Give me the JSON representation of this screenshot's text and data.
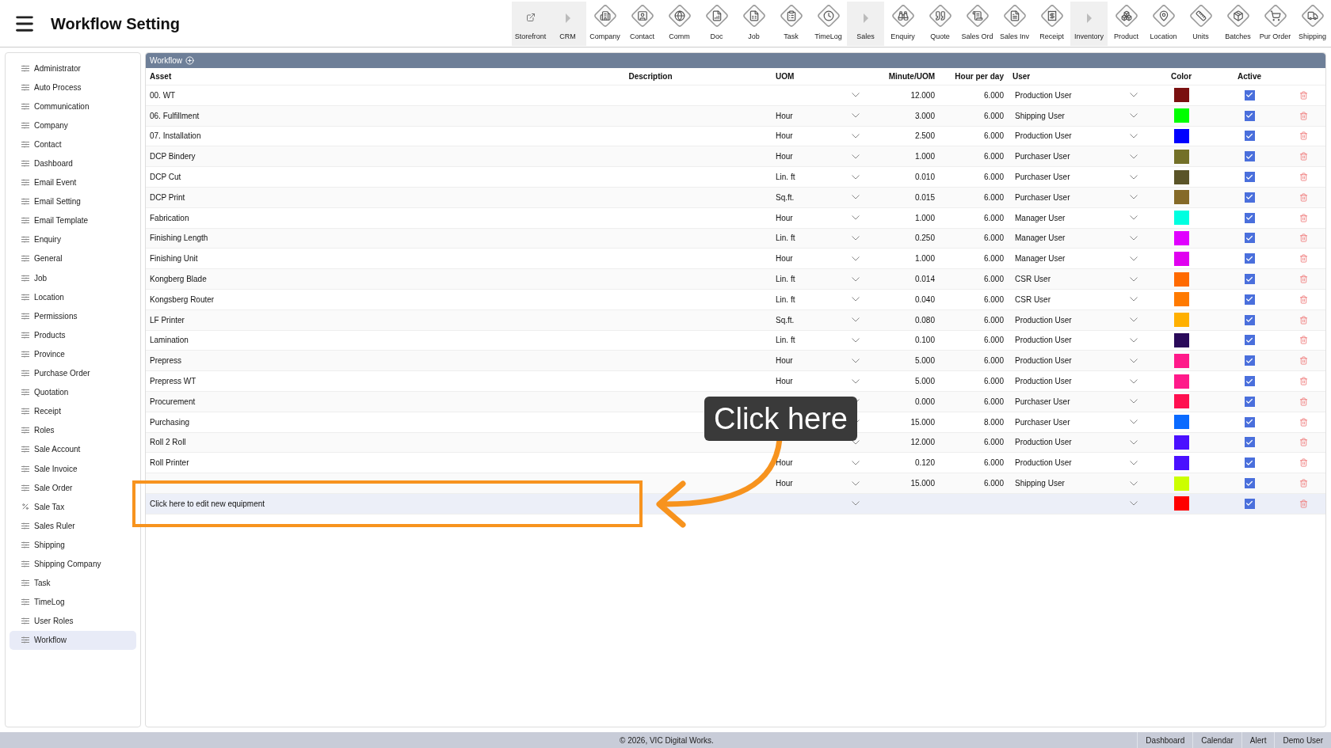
{
  "header": {
    "title": "Workflow Setting"
  },
  "toolbar": [
    {
      "label": "Storefront",
      "kind": "external"
    },
    {
      "label": "CRM",
      "kind": "section"
    },
    {
      "label": "Company",
      "kind": "module"
    },
    {
      "label": "Contact",
      "kind": "module"
    },
    {
      "label": "Comm",
      "kind": "module"
    },
    {
      "label": "Doc",
      "kind": "module"
    },
    {
      "label": "Job",
      "kind": "module"
    },
    {
      "label": "Task",
      "kind": "module"
    },
    {
      "label": "TimeLog",
      "kind": "module"
    },
    {
      "label": "Sales",
      "kind": "section"
    },
    {
      "label": "Enquiry",
      "kind": "module"
    },
    {
      "label": "Quote",
      "kind": "module"
    },
    {
      "label": "Sales Ord",
      "kind": "module"
    },
    {
      "label": "Sales Inv",
      "kind": "module"
    },
    {
      "label": "Receipt",
      "kind": "module"
    },
    {
      "label": "Inventory",
      "kind": "section"
    },
    {
      "label": "Product",
      "kind": "module"
    },
    {
      "label": "Location",
      "kind": "module"
    },
    {
      "label": "Units",
      "kind": "module"
    },
    {
      "label": "Batches",
      "kind": "module"
    },
    {
      "label": "Pur Order",
      "kind": "module"
    },
    {
      "label": "Shipping",
      "kind": "module"
    }
  ],
  "sidebar": {
    "items": [
      {
        "label": "Administrator",
        "kind": "setting",
        "selected": false
      },
      {
        "label": "Auto Process",
        "kind": "setting",
        "selected": false
      },
      {
        "label": "Communication",
        "kind": "setting",
        "selected": false
      },
      {
        "label": "Company",
        "kind": "setting",
        "selected": false
      },
      {
        "label": "Contact",
        "kind": "setting",
        "selected": false
      },
      {
        "label": "Dashboard",
        "kind": "setting",
        "selected": false
      },
      {
        "label": "Email Event",
        "kind": "setting",
        "selected": false
      },
      {
        "label": "Email Setting",
        "kind": "setting",
        "selected": false
      },
      {
        "label": "Email Template",
        "kind": "setting",
        "selected": false
      },
      {
        "label": "Enquiry",
        "kind": "setting",
        "selected": false
      },
      {
        "label": "General",
        "kind": "setting",
        "selected": false
      },
      {
        "label": "Job",
        "kind": "setting",
        "selected": false
      },
      {
        "label": "Location",
        "kind": "setting",
        "selected": false
      },
      {
        "label": "Permissions",
        "kind": "setting",
        "selected": false
      },
      {
        "label": "Products",
        "kind": "setting",
        "selected": false
      },
      {
        "label": "Province",
        "kind": "setting",
        "selected": false
      },
      {
        "label": "Purchase Order",
        "kind": "setting",
        "selected": false
      },
      {
        "label": "Quotation",
        "kind": "setting",
        "selected": false
      },
      {
        "label": "Receipt",
        "kind": "setting",
        "selected": false
      },
      {
        "label": "Roles",
        "kind": "setting",
        "selected": false
      },
      {
        "label": "Sale Account",
        "kind": "setting",
        "selected": false
      },
      {
        "label": "Sale Invoice",
        "kind": "setting",
        "selected": false
      },
      {
        "label": "Sale Order",
        "kind": "setting",
        "selected": false
      },
      {
        "label": "Sale Tax",
        "kind": "tax",
        "selected": false
      },
      {
        "label": "Sales Ruler",
        "kind": "setting",
        "selected": false
      },
      {
        "label": "Shipping",
        "kind": "setting",
        "selected": false
      },
      {
        "label": "Shipping Company",
        "kind": "setting",
        "selected": false
      },
      {
        "label": "Task",
        "kind": "setting",
        "selected": false
      },
      {
        "label": "TimeLog",
        "kind": "setting",
        "selected": false
      },
      {
        "label": "User Roles",
        "kind": "setting",
        "selected": false
      },
      {
        "label": "Workflow",
        "kind": "setting",
        "selected": true
      }
    ]
  },
  "panel": {
    "title": "Workflow"
  },
  "table": {
    "columns": [
      "Asset",
      "Description",
      "UOM",
      "Minute/UOM",
      "Hour per day",
      "User",
      "Color",
      "Active"
    ],
    "rows": [
      {
        "asset": "00. WT",
        "minute": "12.000",
        "hours": "6.000",
        "user": "Production User",
        "color": "#7a1010",
        "active": true,
        "selected": false
      },
      {
        "asset": "06. Fulfillment",
        "uom": "Hour",
        "minute": "3.000",
        "hours": "6.000",
        "user": "Shipping User",
        "color": "#00ff00",
        "active": true,
        "selected": false
      },
      {
        "asset": "07. Installation",
        "uom": "Hour",
        "minute": "2.500",
        "hours": "6.000",
        "user": "Production User",
        "color": "#0000ff",
        "active": true,
        "selected": false
      },
      {
        "asset": "DCP Bindery",
        "uom": "Hour",
        "minute": "1.000",
        "hours": "6.000",
        "user": "Purchaser User",
        "color": "#737028",
        "active": true,
        "selected": false
      },
      {
        "asset": "DCP Cut",
        "uom": "Lin. ft",
        "minute": "0.010",
        "hours": "6.000",
        "user": "Purchaser User",
        "color": "#5a5428",
        "active": true,
        "selected": false
      },
      {
        "asset": "DCP Print",
        "uom": "Sq.ft.",
        "minute": "0.015",
        "hours": "6.000",
        "user": "Purchaser User",
        "color": "#856a28",
        "active": true,
        "selected": false
      },
      {
        "asset": "Fabrication",
        "uom": "Hour",
        "minute": "1.000",
        "hours": "6.000",
        "user": "Manager User",
        "color": "#00ffe0",
        "active": true,
        "selected": false
      },
      {
        "asset": "Finishing Length",
        "uom": "Lin. ft",
        "minute": "0.250",
        "hours": "6.000",
        "user": "Manager User",
        "color": "#e000ff",
        "active": true,
        "selected": false
      },
      {
        "asset": "Finishing Unit",
        "uom": "Hour",
        "minute": "1.000",
        "hours": "6.000",
        "user": "Manager User",
        "color": "#e000f0",
        "active": true,
        "selected": false
      },
      {
        "asset": "Kongberg Blade",
        "uom": "Lin. ft",
        "minute": "0.014",
        "hours": "6.000",
        "user": "CSR User",
        "color": "#ff6a00",
        "active": true,
        "selected": false
      },
      {
        "asset": "Kongsberg Router",
        "uom": "Lin. ft",
        "minute": "0.040",
        "hours": "6.000",
        "user": "CSR User",
        "color": "#ff7a00",
        "active": true,
        "selected": false
      },
      {
        "asset": "LF Printer",
        "uom": "Sq.ft.",
        "minute": "0.080",
        "hours": "6.000",
        "user": "Production User",
        "color": "#ffb000",
        "active": true,
        "selected": false
      },
      {
        "asset": "Lamination",
        "uom": "Lin. ft",
        "minute": "0.100",
        "hours": "6.000",
        "user": "Production User",
        "color": "#2a0a5a",
        "active": true,
        "selected": false
      },
      {
        "asset": "Prepress",
        "uom": "Hour",
        "minute": "5.000",
        "hours": "6.000",
        "user": "Production User",
        "color": "#ff1a8a",
        "active": true,
        "selected": false
      },
      {
        "asset": "Prepress WT",
        "uom": "Hour",
        "minute": "5.000",
        "hours": "6.000",
        "user": "Production User",
        "color": "#ff1a8a",
        "active": true,
        "selected": false
      },
      {
        "asset": "Procurement",
        "minute": "0.000",
        "hours": "6.000",
        "user": "Purchaser User",
        "color": "#ff1050",
        "active": true,
        "selected": false
      },
      {
        "asset": "Purchasing",
        "minute": "15.000",
        "hours": "8.000",
        "user": "Purchaser User",
        "color": "#0a6aff",
        "active": true,
        "selected": false
      },
      {
        "asset": "Roll 2 Roll",
        "minute": "12.000",
        "hours": "6.000",
        "user": "Production User",
        "color": "#4a10ff",
        "active": true,
        "selected": false
      },
      {
        "asset": "Roll Printer",
        "uom": "Hour",
        "minute": "0.120",
        "hours": "6.000",
        "user": "Production User",
        "color": "#4a10ff",
        "active": true,
        "selected": false
      },
      {
        "uom": "Hour",
        "minute": "15.000",
        "hours": "6.000",
        "user": "Shipping User",
        "color": "#ccff00",
        "active": true,
        "selected": false
      },
      {
        "asset": "Click here to edit new equipment",
        "color": "#ff0000",
        "active": true,
        "selected": true
      }
    ]
  },
  "callout": {
    "text": "Click here"
  },
  "footer": {
    "copyright": "© 2026, VIC Digital Works.",
    "links": [
      "Dashboard",
      "Calendar",
      "Alert",
      "Demo User"
    ]
  }
}
